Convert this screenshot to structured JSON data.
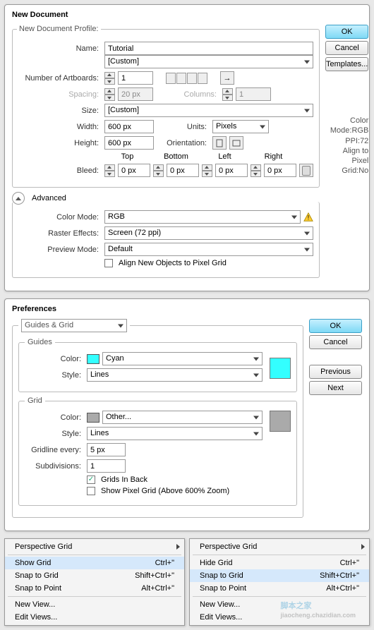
{
  "newDoc": {
    "title": "New Document",
    "name_label": "Name:",
    "name_value": "Tutorial",
    "profile_label": "New Document Profile:",
    "profile_value": "[Custom]",
    "artboards_label": "Number of Artboards:",
    "artboards_value": "1",
    "spacing_label": "Spacing:",
    "spacing_value": "20 px",
    "columns_label": "Columns:",
    "columns_value": "1",
    "size_label": "Size:",
    "size_value": "[Custom]",
    "width_label": "Width:",
    "width_value": "600 px",
    "units_label": "Units:",
    "units_value": "Pixels",
    "height_label": "Height:",
    "height_value": "600 px",
    "orient_label": "Orientation:",
    "bleed_label": "Bleed:",
    "bleed_top": "Top",
    "bleed_bottom": "Bottom",
    "bleed_left": "Left",
    "bleed_right": "Right",
    "bleed_val": "0 px",
    "advanced": "Advanced",
    "colormode_label": "Color Mode:",
    "colormode_value": "RGB",
    "raster_label": "Raster Effects:",
    "raster_value": "Screen (72 ppi)",
    "preview_label": "Preview Mode:",
    "preview_value": "Default",
    "align_check": "Align New Objects to Pixel Grid",
    "info1": "Color Mode:RGB",
    "info2": "PPI:72",
    "info3": "Align to Pixel Grid:No",
    "ok": "OK",
    "cancel": "Cancel",
    "templates": "Templates..."
  },
  "prefs": {
    "title": "Preferences",
    "section": "Guides & Grid",
    "guides_legend": "Guides",
    "color_label": "Color:",
    "guides_color": "Cyan",
    "style_label": "Style:",
    "style_value": "Lines",
    "grid_legend": "Grid",
    "grid_color": "Other...",
    "gridline_label": "Gridline every:",
    "gridline_value": "5 px",
    "subdiv_label": "Subdivisions:",
    "subdiv_value": "1",
    "grids_back": "Grids In Back",
    "show_pixel": "Show Pixel Grid (Above 600% Zoom)",
    "ok": "OK",
    "cancel": "Cancel",
    "previous": "Previous",
    "next": "Next"
  },
  "menu1": {
    "persp": "Perspective Grid",
    "showgrid": "Show Grid",
    "showgrid_key": "Ctrl+\"",
    "snapgrid": "Snap to Grid",
    "snapgrid_key": "Shift+Ctrl+\"",
    "snappoint": "Snap to Point",
    "snappoint_key": "Alt+Ctrl+\"",
    "newview": "New View...",
    "editviews": "Edit Views..."
  },
  "menu2": {
    "persp": "Perspective Grid",
    "hidegrid": "Hide Grid",
    "hidegrid_key": "Ctrl+\"",
    "snapgrid": "Snap to Grid",
    "snapgrid_key": "Shift+Ctrl+\"",
    "snappoint": "Snap to Point",
    "snappoint_key": "Alt+Ctrl+\"",
    "newview": "New View...",
    "editviews": "Edit Views..."
  },
  "watermark": {
    "main": "脚本之家",
    "sub": "jiaocheng.chazidian.com"
  }
}
